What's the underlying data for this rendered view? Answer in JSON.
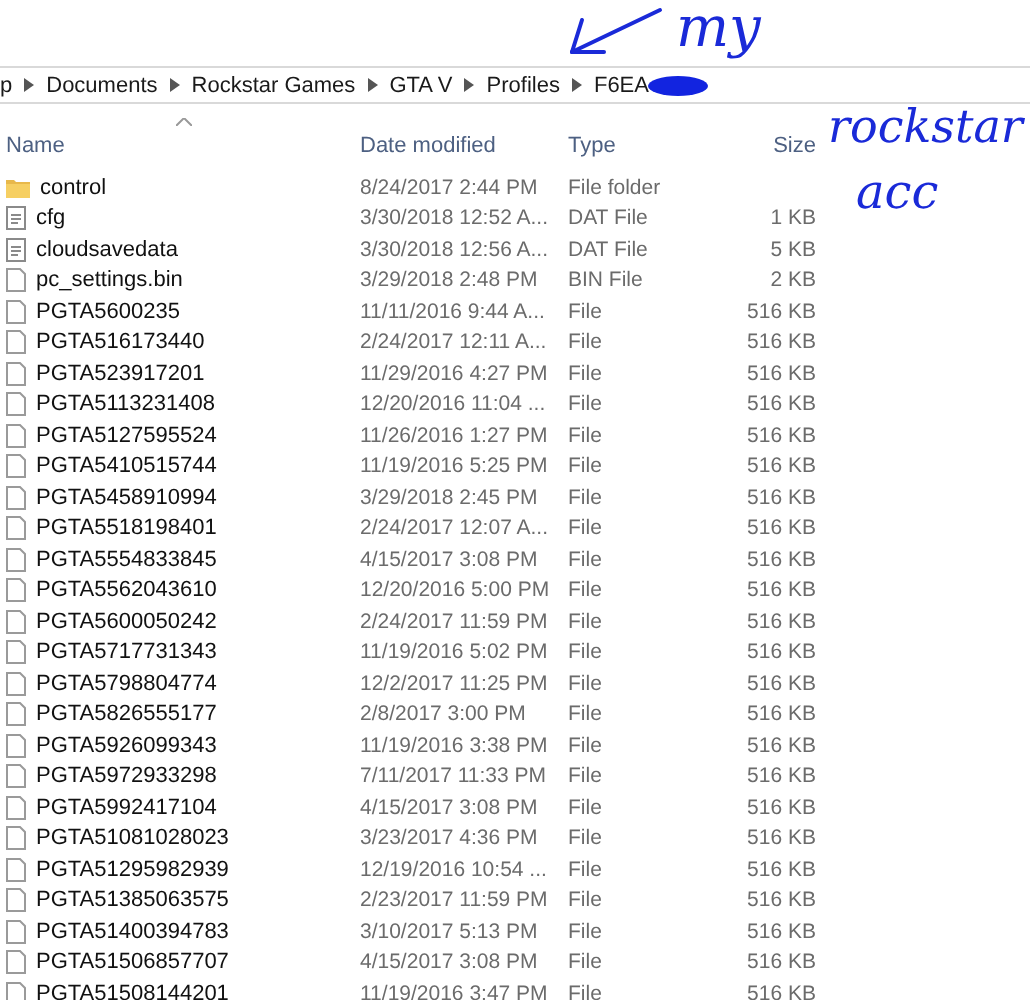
{
  "breadcrumb": [
    "p",
    "Documents",
    "Rockstar Games",
    "GTA V",
    "Profiles",
    "F6EA"
  ],
  "columns": [
    "Name",
    "Date modified",
    "Type",
    "Size"
  ],
  "rows": [
    {
      "kind": "folder",
      "name": "control",
      "date": "8/24/2017 2:44 PM",
      "type": "File folder"
    },
    {
      "kind": "data",
      "name": "cfg",
      "date": "3/30/2018 12:52 A...",
      "type": "DAT File",
      "size": "1 KB"
    },
    {
      "kind": "data",
      "name": "cloudsavedata",
      "date": "3/30/2018 12:56 A...",
      "type": "DAT File",
      "size": "5 KB"
    },
    {
      "kind": "file",
      "name": "pc_settings.bin",
      "date": "3/29/2018 2:48 PM",
      "type": "BIN File",
      "size": "2 KB"
    },
    {
      "kind": "file",
      "name": "PGTA5600235",
      "date": "11/11/2016 9:44 A...",
      "type": "File",
      "size": "516 KB"
    },
    {
      "kind": "file",
      "name": "PGTA516173440",
      "date": "2/24/2017 12:11 A...",
      "type": "File",
      "size": "516 KB"
    },
    {
      "kind": "file",
      "name": "PGTA523917201",
      "date": "11/29/2016 4:27 PM",
      "type": "File",
      "size": "516 KB"
    },
    {
      "kind": "file",
      "name": "PGTA5113231408",
      "date": "12/20/2016 11:04 ...",
      "type": "File",
      "size": "516 KB"
    },
    {
      "kind": "file",
      "name": "PGTA5127595524",
      "date": "11/26/2016 1:27 PM",
      "type": "File",
      "size": "516 KB"
    },
    {
      "kind": "file",
      "name": "PGTA5410515744",
      "date": "11/19/2016 5:25 PM",
      "type": "File",
      "size": "516 KB"
    },
    {
      "kind": "file",
      "name": "PGTA5458910994",
      "date": "3/29/2018 2:45 PM",
      "type": "File",
      "size": "516 KB"
    },
    {
      "kind": "file",
      "name": "PGTA5518198401",
      "date": "2/24/2017 12:07 A...",
      "type": "File",
      "size": "516 KB"
    },
    {
      "kind": "file",
      "name": "PGTA5554833845",
      "date": "4/15/2017 3:08 PM",
      "type": "File",
      "size": "516 KB"
    },
    {
      "kind": "file",
      "name": "PGTA5562043610",
      "date": "12/20/2016 5:00 PM",
      "type": "File",
      "size": "516 KB"
    },
    {
      "kind": "file",
      "name": "PGTA5600050242",
      "date": "2/24/2017 11:59 PM",
      "type": "File",
      "size": "516 KB"
    },
    {
      "kind": "file",
      "name": "PGTA5717731343",
      "date": "11/19/2016 5:02 PM",
      "type": "File",
      "size": "516 KB"
    },
    {
      "kind": "file",
      "name": "PGTA5798804774",
      "date": "12/2/2017 11:25 PM",
      "type": "File",
      "size": "516 KB"
    },
    {
      "kind": "file",
      "name": "PGTA5826555177",
      "date": "2/8/2017 3:00 PM",
      "type": "File",
      "size": "516 KB"
    },
    {
      "kind": "file",
      "name": "PGTA5926099343",
      "date": "11/19/2016 3:38 PM",
      "type": "File",
      "size": "516 KB"
    },
    {
      "kind": "file",
      "name": "PGTA5972933298",
      "date": "7/11/2017 11:33 PM",
      "type": "File",
      "size": "516 KB"
    },
    {
      "kind": "file",
      "name": "PGTA5992417104",
      "date": "4/15/2017 3:08 PM",
      "type": "File",
      "size": "516 KB"
    },
    {
      "kind": "file",
      "name": "PGTA51081028023",
      "date": "3/23/2017 4:36 PM",
      "type": "File",
      "size": "516 KB"
    },
    {
      "kind": "file",
      "name": "PGTA51295982939",
      "date": "12/19/2016 10:54 ...",
      "type": "File",
      "size": "516 KB"
    },
    {
      "kind": "file",
      "name": "PGTA51385063575",
      "date": "2/23/2017 11:59 PM",
      "type": "File",
      "size": "516 KB"
    },
    {
      "kind": "file",
      "name": "PGTA51400394783",
      "date": "3/10/2017 5:13 PM",
      "type": "File",
      "size": "516 KB"
    },
    {
      "kind": "file",
      "name": "PGTA51506857707",
      "date": "4/15/2017 3:08 PM",
      "type": "File",
      "size": "516 KB"
    },
    {
      "kind": "file",
      "name": "PGTA51508144201",
      "date": "11/19/2016 3:47 PM",
      "type": "File",
      "size": "516 KB"
    }
  ],
  "annotation": [
    "my",
    "rockstar",
    "acc"
  ]
}
